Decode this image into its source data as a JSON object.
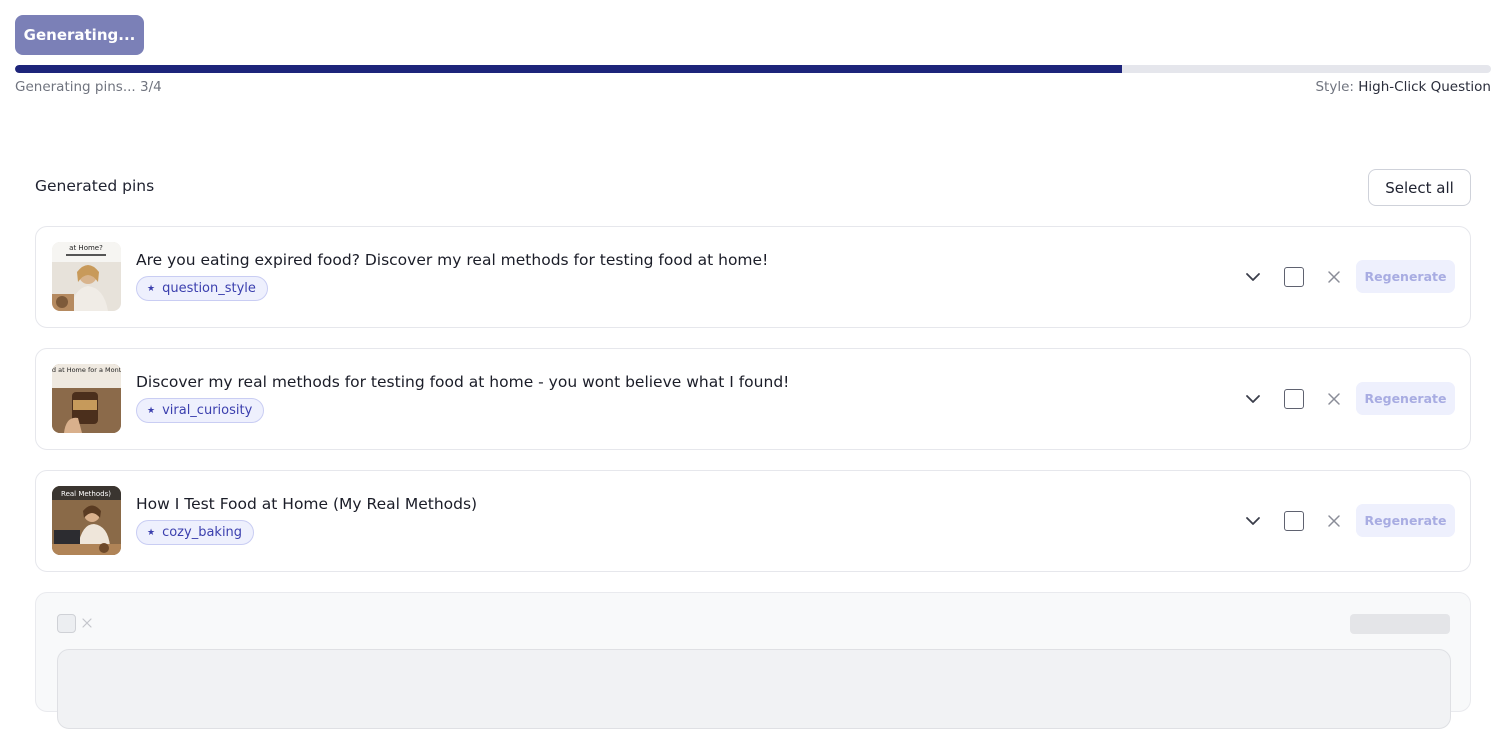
{
  "header": {
    "generate_button": "Generating...",
    "progress_text": "Generating pins... 3/4",
    "progress_fraction": 0.75,
    "style_label": "Style:",
    "style_value": "High-Click Question"
  },
  "section": {
    "title": "Generated pins",
    "select_all": "Select all"
  },
  "pins": [
    {
      "title": "Are you eating expired food? Discover my real methods for testing food at home!",
      "tag": "question_style",
      "regenerate": "Regenerate",
      "thumb_caption": "at Home?"
    },
    {
      "title": "Discover my real methods for testing food at home - you wont believe what I found!",
      "tag": "viral_curiosity",
      "regenerate": "Regenerate",
      "thumb_caption": "Food at Home for a Month..."
    },
    {
      "title": "How I Test Food at Home (My Real Methods)",
      "tag": "cozy_baking",
      "regenerate": "Regenerate",
      "thumb_caption": "Real Methods)"
    }
  ],
  "icons": {
    "tag_star": "star-icon",
    "expand": "chevron-down-icon",
    "remove": "close-icon"
  },
  "colors": {
    "accent": "#1d247a",
    "button_disabled": "#7b80b7",
    "tag_bg": "#eef0fd",
    "tag_text": "#3b3fae"
  }
}
